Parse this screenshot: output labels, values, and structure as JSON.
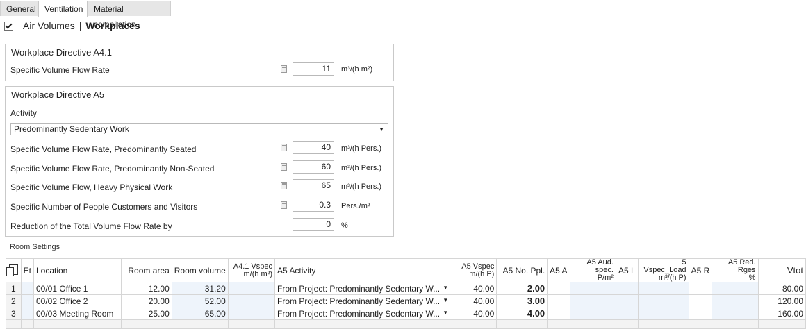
{
  "tabs": [
    {
      "label": "General",
      "active": false
    },
    {
      "label": "Ventilation",
      "active": true
    },
    {
      "label": "Material compilation",
      "active": false
    }
  ],
  "header": {
    "checkbox_checked": true,
    "section": "Air Volumes",
    "separator": "|",
    "title": "Workplaces"
  },
  "a41": {
    "title": "Workplace Directive A4.1",
    "label": "Specific Volume Flow Rate",
    "value": "11",
    "unit": "m³/(h m²)"
  },
  "a5": {
    "title": "Workplace Directive A5",
    "activity_label": "Activity",
    "activity_value": "Predominantly Sedentary Work",
    "rows": [
      {
        "label": "Specific Volume Flow Rate, Predominantly Seated",
        "value": "40",
        "unit": "m³/(h Pers.)",
        "calc": true
      },
      {
        "label": "Specific Volume Flow Rate, Predominantly Non-Seated",
        "value": "60",
        "unit": "m³/(h Pers.)",
        "calc": true
      },
      {
        "label": "Specific Volume Flow, Heavy Physical Work",
        "value": "65",
        "unit": "m³/(h Pers.)",
        "calc": true
      },
      {
        "label": "Specific Number of People Customers and Visitors",
        "value": "0.3",
        "unit": "Pers./m²",
        "calc": true
      },
      {
        "label": "Reduction of the Total Volume Flow Rate by",
        "value": "0",
        "unit": "%",
        "calc": false
      }
    ]
  },
  "room_settings": {
    "title": "Room Settings",
    "columns": {
      "et": "Et",
      "location": "Location",
      "room_area": "Room area",
      "room_volume": "Room volume",
      "a41_vspec_1": "A4.1 Vspec",
      "a41_vspec_2": "m/(h m²)",
      "a5_activity": "A5 Activity",
      "a5_vspec_1": "A5 Vspec",
      "a5_vspec_2": "m/(h P)",
      "a5_no_ppl": "A5 No. Ppl.",
      "a5_a": "A5 A",
      "a5_aud_1": "A5 Aud. spec.",
      "a5_aud_2": "P/m²",
      "a5_l": "A5 L",
      "a5_vload_1": "5 Vspec_Load",
      "a5_vload_2": "m³/(h P)",
      "a5_r": "A5 R",
      "a5_red_1": "A5 Red. Rges",
      "a5_red_2": "%",
      "vtot": "Vtot"
    },
    "rows": [
      {
        "idx": "1",
        "location": "00/01 Office 1",
        "area": "12.00",
        "volume": "31.20",
        "activity": "From Project: Predominantly Sedentary W...",
        "vspec": "40.00",
        "ppl": "2.00",
        "vtot": "80.00"
      },
      {
        "idx": "2",
        "location": "00/02 Office 2",
        "area": "20.00",
        "volume": "52.00",
        "activity": "From Project: Predominantly Sedentary W...",
        "vspec": "40.00",
        "ppl": "3.00",
        "vtot": "120.00"
      },
      {
        "idx": "3",
        "location": "00/03 Meeting Room",
        "area": "25.00",
        "volume": "65.00",
        "activity": "From Project: Predominantly Sedentary W...",
        "vspec": "40.00",
        "ppl": "4.00",
        "vtot": "160.00"
      }
    ]
  }
}
